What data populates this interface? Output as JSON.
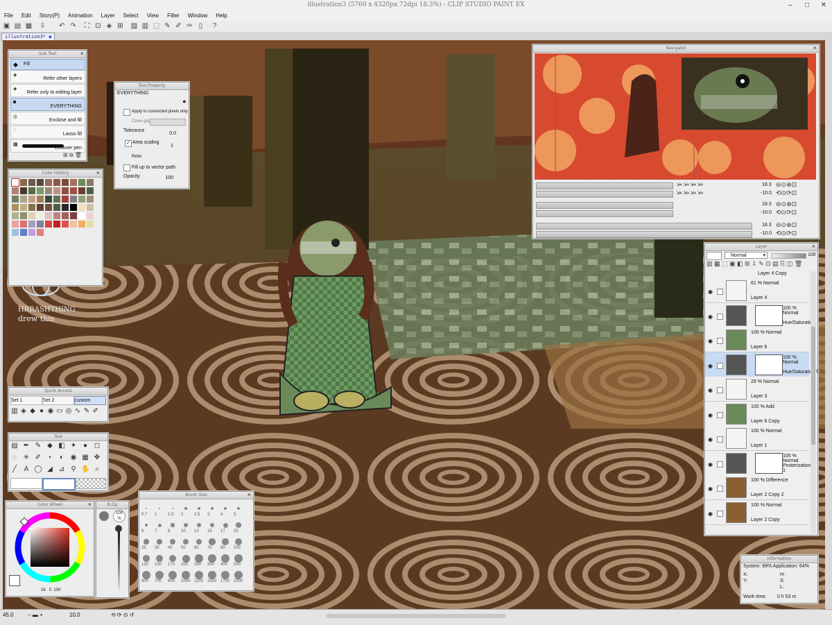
{
  "app": {
    "title": "illustration3 (5760 x 4320px 72dpi 18.3%)  - CLIP STUDIO PAINT EX",
    "document_tab": "illustration3*",
    "window_controls": [
      "–",
      "□",
      "✕"
    ]
  },
  "menu": [
    "File",
    "Edit",
    "Story(P)",
    "Animation",
    "Layer",
    "Select",
    "View",
    "Filter",
    "Window",
    "Help"
  ],
  "command_bar_icons": [
    "new-icon",
    "open-icon",
    "save-icon",
    "undo-icon",
    "redo-icon",
    "select-all-icon",
    "deselect-icon",
    "fill-icon",
    "transform-icon",
    "snap-icon",
    "ruler-icon",
    "pen-icon",
    "brush-icon",
    "settings-icon",
    "help-icon"
  ],
  "sub_tool": {
    "title": "Sub Tool",
    "header": "Fill",
    "items": [
      {
        "label": "Refer other layers",
        "icon": "fill-other-icon",
        "selected": false
      },
      {
        "label": "Refer only to editing layer",
        "icon": "fill-editing-icon",
        "selected": false
      },
      {
        "label": "EVERYTHING",
        "icon": "fill-everything-icon",
        "selected": true
      },
      {
        "label": "Enclose and fill",
        "icon": "enclose-fill-icon",
        "selected": false
      },
      {
        "label": "Lasso fill",
        "icon": "lasso-fill-icon",
        "selected": false
      },
      {
        "label": "Leftover pen",
        "icon": "leftover-pen-icon",
        "selected": false
      }
    ]
  },
  "tool_property": {
    "title": "Tool Property",
    "tool_name": "EVERYTHING",
    "apply_connected": "Apply to connected pixels only",
    "close_gap": "Close gap",
    "tolerance_label": "Tolerance",
    "tolerance_value": "0.0",
    "area_scaling_label": "Area scaling",
    "area_scaling_value": "1",
    "refer_label": "Refer",
    "fill_vector": "Fill up to vector path",
    "opacity_label": "Opacity",
    "opacity_value": "100"
  },
  "color_history": {
    "title": "Color History",
    "colors": [
      "#ffffff",
      "#8a6a4a",
      "#6b5c4a",
      "#5a4a3a",
      "#9b6b5b",
      "#8b5a4a",
      "#7a4a3a",
      "#a07060",
      "#6b8b5b",
      "#8a7a6a",
      "#b08070",
      "#4a3a2a",
      "#5a6a4a",
      "#7a9a6a",
      "#9a8a7a",
      "#c09080",
      "#8a5040",
      "#a05040",
      "#6a4030",
      "#50604a",
      "#708060",
      "#b0a090",
      "#c0a080",
      "#a08050",
      "#3a4a3a",
      "#607050",
      "#a04040",
      "#808080",
      "#90a080",
      "#a09070",
      "#b09060",
      "#c0b080",
      "#8a7050",
      "#604030",
      "#705040",
      "#506040",
      "#2a2a2a",
      "#000000",
      "#f0e0c0",
      "#d0c0a0",
      "#b0b090",
      "#909070",
      "#e0d0b0",
      "#f0f0e0",
      "#e0c0c0",
      "#c08080",
      "#a06060",
      "#804040",
      "#ffffff",
      "#f0d0d0",
      "#f0a0a0",
      "#e07070",
      "#a0a0c0",
      "#8080a0",
      "#e04040",
      "#c02020",
      "#e05050",
      "#f0c0a0",
      "#f0b060",
      "#e0e0a0",
      "#a0c0e0",
      "#6080c0",
      "#c0a0e0",
      "#e08080"
    ]
  },
  "watermark": {
    "line1": "HRRASHTHING",
    "line2": "drew this"
  },
  "quick_access": {
    "title": "Quick Access",
    "sets": [
      "Set 1",
      "Set 2",
      "custom"
    ],
    "icons": [
      "layers-icon",
      "cube-icon",
      "fill-icon",
      "drop-icon",
      "blend-icon",
      "frame-icon",
      "record-icon",
      "curve-icon",
      "pen-icon",
      "brush-icon"
    ]
  },
  "tool_palette": {
    "title": "Tool",
    "icons": [
      "layer-tool-icon",
      "pen-tool-icon",
      "highlighter-icon",
      "eraser-icon",
      "fill-bucket-icon",
      "sparkle-icon",
      "drop-tool-icon",
      "select-icon",
      "lasso-icon",
      "wand-icon",
      "pencil-icon",
      "star-tool-icon",
      "blend-tool-icon",
      "fill-tool-icon",
      "gradient-icon",
      "move-icon",
      "line-icon",
      "text-icon",
      "balloon-icon",
      "ruler-tool-icon",
      "frame-tool-icon",
      "eyedropper-icon",
      "hand-icon",
      "zoom-icon"
    ]
  },
  "color_wheel": {
    "title": "Color Wheel",
    "hue_color": "#e03020",
    "readouts": [
      "16",
      "0",
      "100"
    ]
  },
  "brush_opacity": {
    "title": "B.Op",
    "value": "100"
  },
  "brush_size": {
    "title": "Brush Size",
    "sizes": [
      "0.7",
      "1",
      "1.5",
      "2",
      "2.5",
      "3",
      "4",
      "5",
      "6",
      "7",
      "8",
      "10",
      "12",
      "15",
      "17",
      "20",
      "25",
      "30",
      "40",
      "50",
      "60",
      "70",
      "80",
      "100",
      "120",
      "150",
      "170",
      "200",
      "250",
      "300",
      "400",
      "500",
      "600",
      "700",
      "800",
      "1000",
      "1200",
      "1500",
      "1700",
      "2000"
    ]
  },
  "navigator": {
    "title": "Navigator",
    "zoom_value": "18.3",
    "rotate_value": "-10.0"
  },
  "layers": {
    "title": "Layer",
    "blend_mode": "Normal",
    "opacity": "100",
    "top_partial": "Layer 4 Copy",
    "rows": [
      {
        "mode": "61 % Normal",
        "name": "Layer 4",
        "kind": "sketch",
        "selected": false
      },
      {
        "mode": "100 % Normal",
        "name": "Hue/Saturation",
        "kind": "correction",
        "selected": false
      },
      {
        "mode": "100 % Normal",
        "name": "Layer 6",
        "kind": "figure",
        "selected": false
      },
      {
        "mode": "100 % Normal",
        "name": "Hue/Saturation/Lu",
        "kind": "correction",
        "selected": true
      },
      {
        "mode": "29 % Normal",
        "name": "Layer 3",
        "kind": "sketch",
        "selected": false
      },
      {
        "mode": "100 % Add",
        "name": "Layer 6 Copy",
        "kind": "figure",
        "selected": false
      },
      {
        "mode": "100 % Normal",
        "name": "Layer 1",
        "kind": "sketch",
        "selected": false
      },
      {
        "mode": "100 % Normal",
        "name": "Posterization 1",
        "kind": "correction",
        "selected": false
      },
      {
        "mode": "100 % Difference",
        "name": "Layer 2 Copy 2",
        "kind": "photo",
        "selected": false
      },
      {
        "mode": "100 % Normal",
        "name": "Layer 2 Copy",
        "kind": "photo",
        "selected": false
      }
    ]
  },
  "information": {
    "title": "Information",
    "system": "System: 89%  Application: 64%",
    "x_label": "X:",
    "y_label": "Y:",
    "h_label": "H:",
    "w_label": "W:",
    "s_label": "S:",
    "l_label": "L:",
    "work_time_label": "Work time:",
    "work_time": "0 h 53 m"
  },
  "status": {
    "zoom": "45.0",
    "rotate": "10.0"
  }
}
